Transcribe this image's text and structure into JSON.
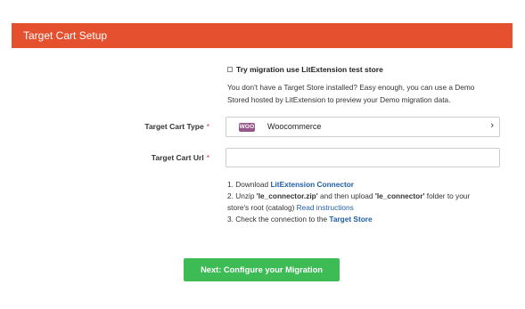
{
  "header": {
    "title": "Target Cart Setup"
  },
  "test_store": {
    "checkbox_label": "Try migration use LitExtension test store",
    "checked": false,
    "hint_line1": "You don't have a Target Store installed? Easy enough, you can use a Demo",
    "hint_line2": "Stored hosted by LitExtension to preview your Demo migration data."
  },
  "cart_type": {
    "label": "Target Cart Type",
    "required_mark": "*",
    "logo_text": "WOO",
    "value": "Woocommerce",
    "chevron": "›"
  },
  "cart_url": {
    "label": "Target Cart Url",
    "required_mark": "*",
    "value": "",
    "placeholder": ""
  },
  "steps": {
    "step1_prefix": "1. Download ",
    "step1_link": "LitExtension Connector",
    "step2_prefix": "2. Unzip ",
    "step2_file": "'le_connector.zip'",
    "step2_middle": " and then upload ",
    "step2_folder": "'le_connector'",
    "step2_suffix": " folder to your",
    "step2_line2": "store's root (catalog) ",
    "step2_link": "Read instructions",
    "step3_prefix": "3. Check the connection to the ",
    "step3_link": "Target Store"
  },
  "actions": {
    "next_label": "Next: Configure your Migration"
  },
  "colors": {
    "header_bg": "#e5502f",
    "button_bg": "#3dbb55",
    "link": "#1f5fa8",
    "required": "#e03131",
    "woo_logo": "#96588a"
  }
}
